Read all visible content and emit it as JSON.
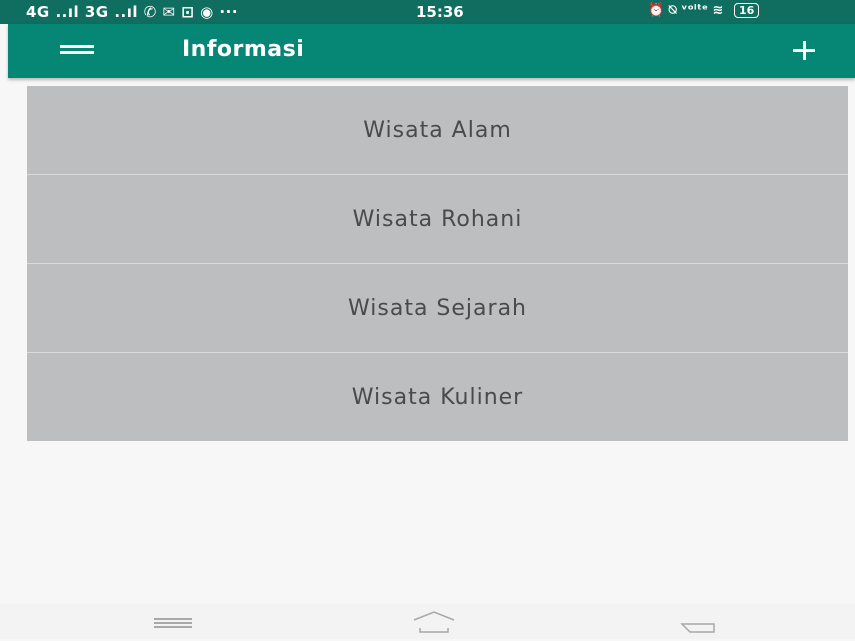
{
  "status_bar": {
    "left_text": "4G ..ıl 3G ..ıl ✆ ✉ ⊡ ◉ ···",
    "time": "15:36",
    "right_text": "⏰ ⍉ ᵛᵒˡᵗᵉ ≋",
    "battery": "16"
  },
  "app_bar": {
    "title": "Informasi",
    "menu_icon": "hamburger-menu-icon",
    "action_icon": "plus-icon"
  },
  "menu_items": [
    {
      "label": "Wisata Alam"
    },
    {
      "label": "Wisata Rohani"
    },
    {
      "label": "Wisata Sejarah"
    },
    {
      "label": "Wisata Kuliner"
    }
  ],
  "nav_bar": {
    "icons": [
      "menu-icon",
      "home-icon",
      "back-icon"
    ]
  },
  "colors": {
    "status_bar": "#0f6e5f",
    "app_bar": "#068674",
    "list_background": "#bdbec0",
    "page_background": "#f7f7f7",
    "item_text": "#4a4a4a"
  }
}
